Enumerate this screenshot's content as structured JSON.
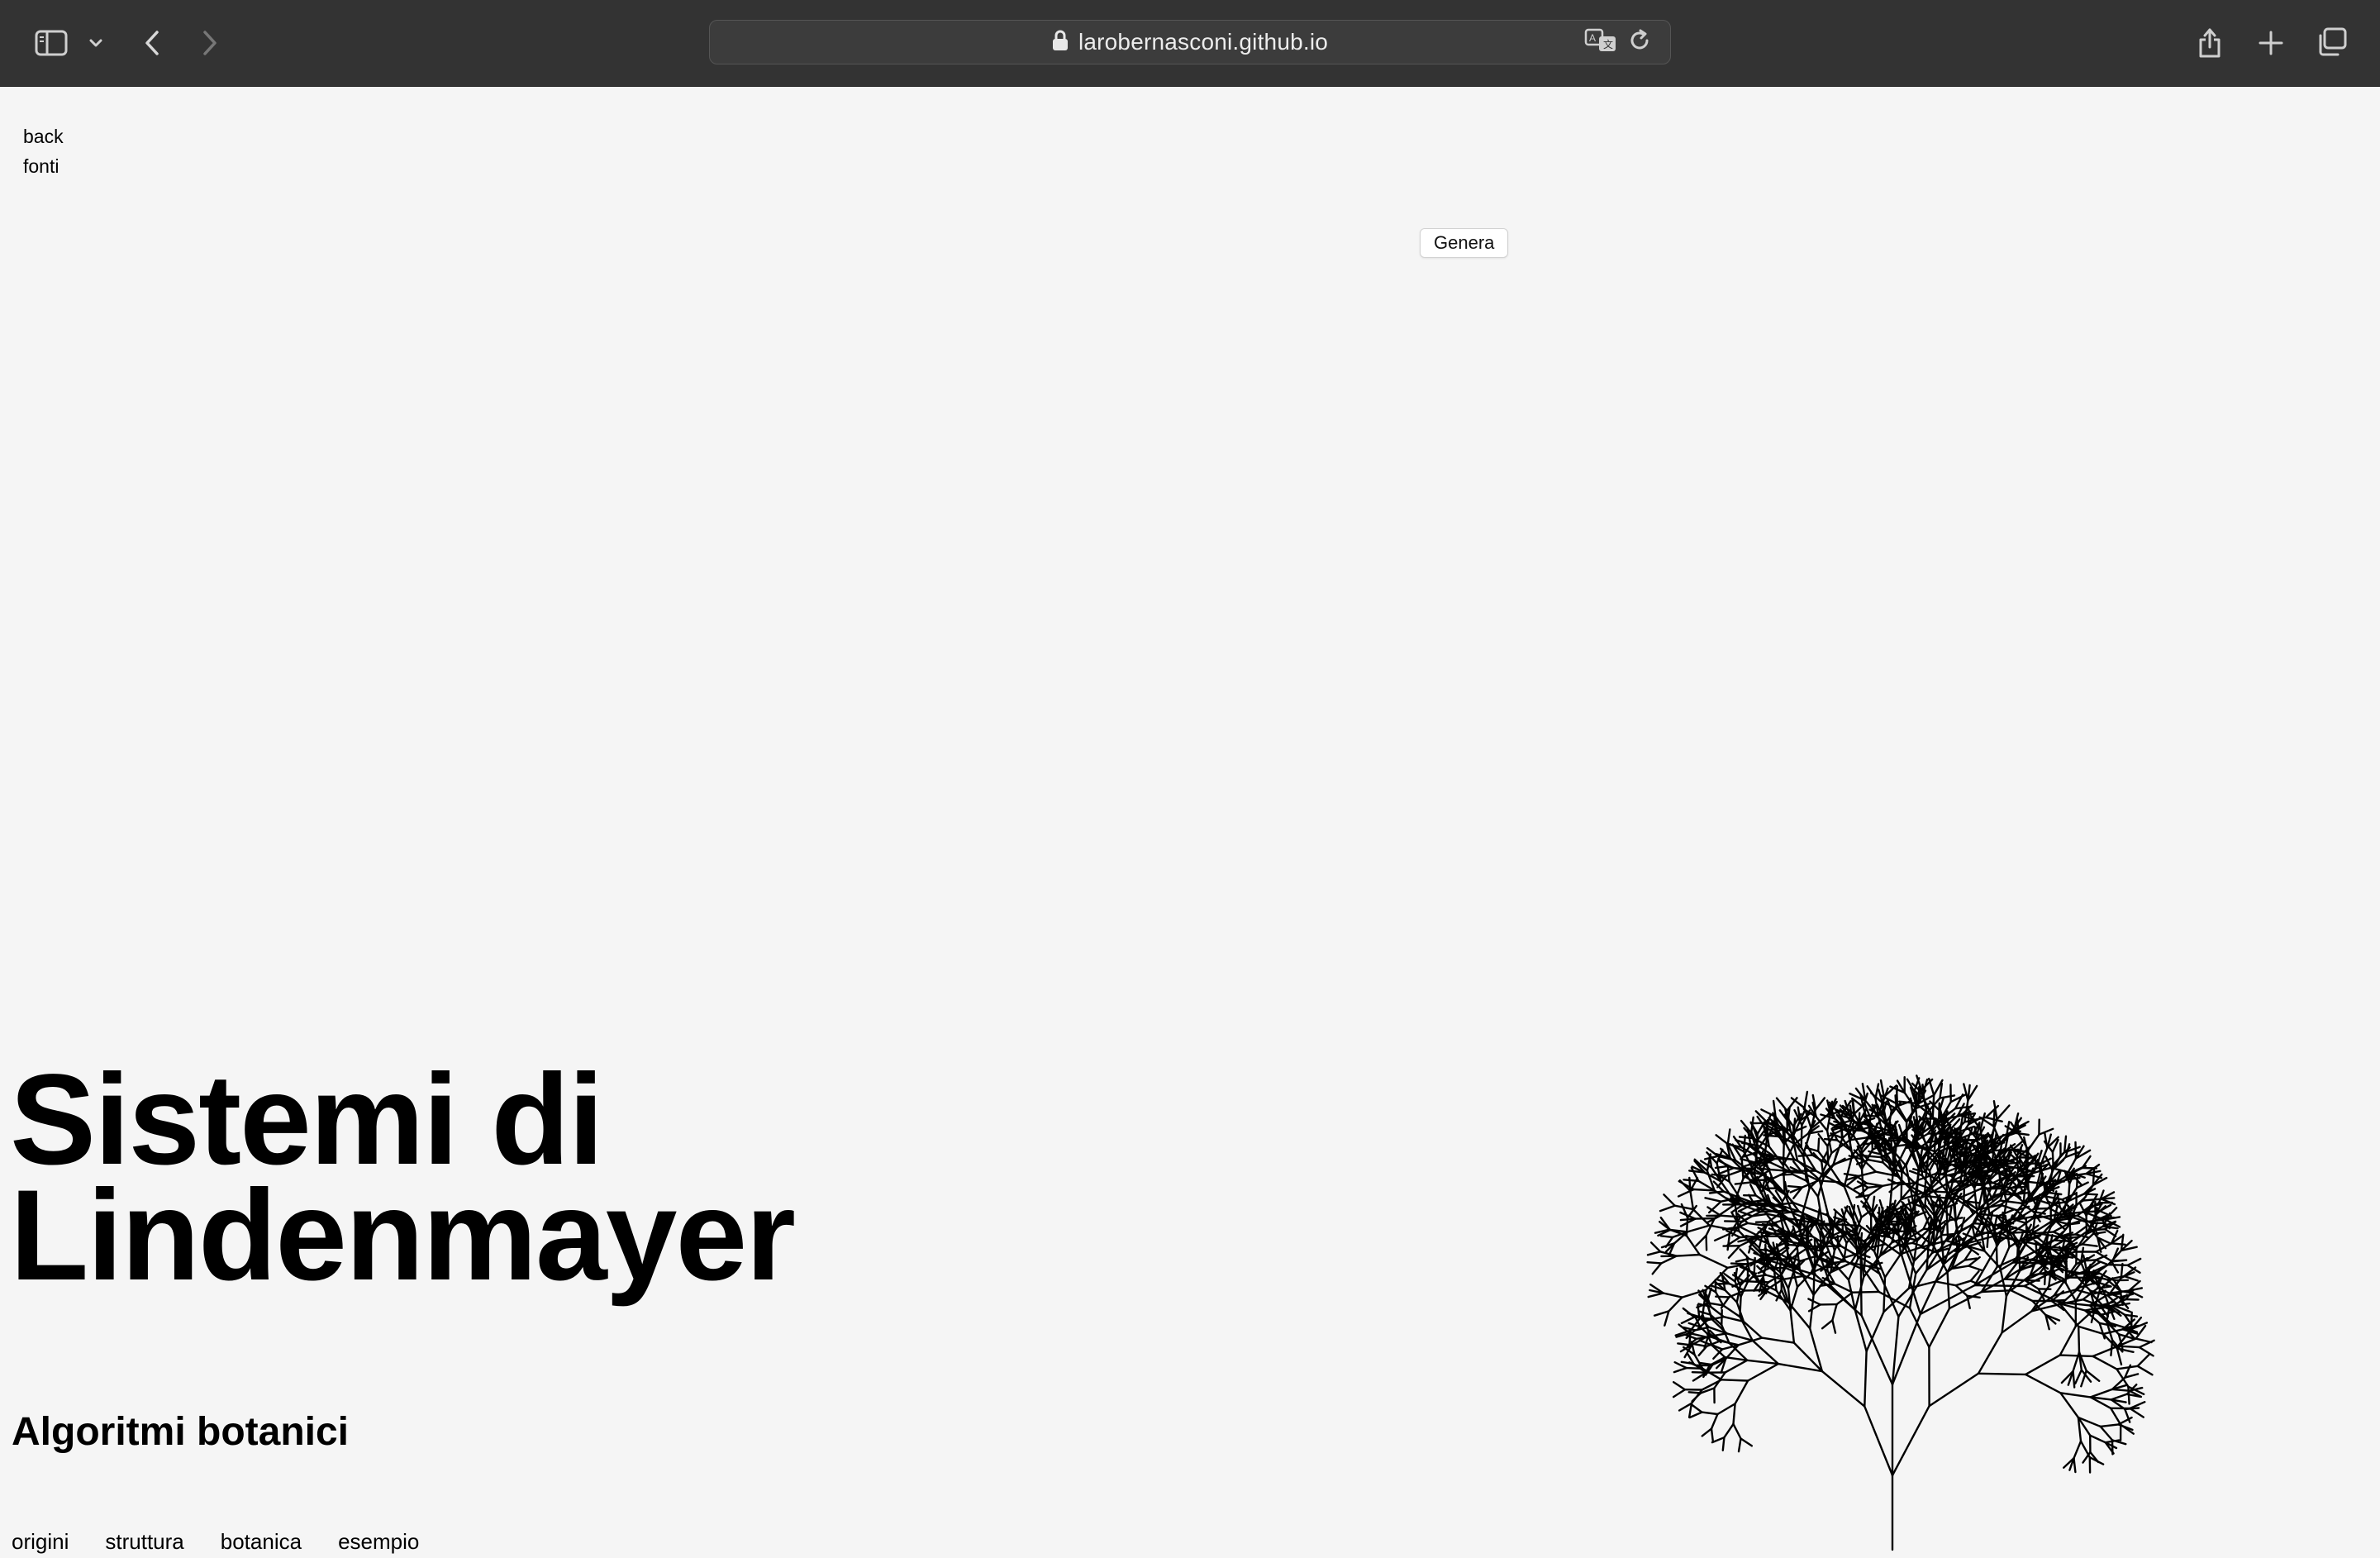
{
  "browser": {
    "url": "larobernasconi.github.io",
    "icons": {
      "sidebar": "sidebar-icon",
      "chevron": "chevron-down-icon",
      "back": "back-arrow-icon",
      "forward": "forward-arrow-icon",
      "lock": "lock-icon",
      "translate": "translate-icon",
      "reload": "reload-icon",
      "share": "share-icon",
      "new_tab": "plus-icon",
      "tabs": "tab-overview-icon"
    }
  },
  "page": {
    "links": {
      "back": "back",
      "fonti": "fonti"
    },
    "generate_button": "Genera",
    "title_line1": "Sistemi di",
    "title_line2": "Lindenmayer",
    "subtitle": "Algoritmi botanici",
    "nav": [
      {
        "label": "origini"
      },
      {
        "label": "struttura"
      },
      {
        "label": "botanica"
      },
      {
        "label": "esempio"
      }
    ],
    "tree_color": "#000000",
    "background": "#f5f5f5"
  }
}
